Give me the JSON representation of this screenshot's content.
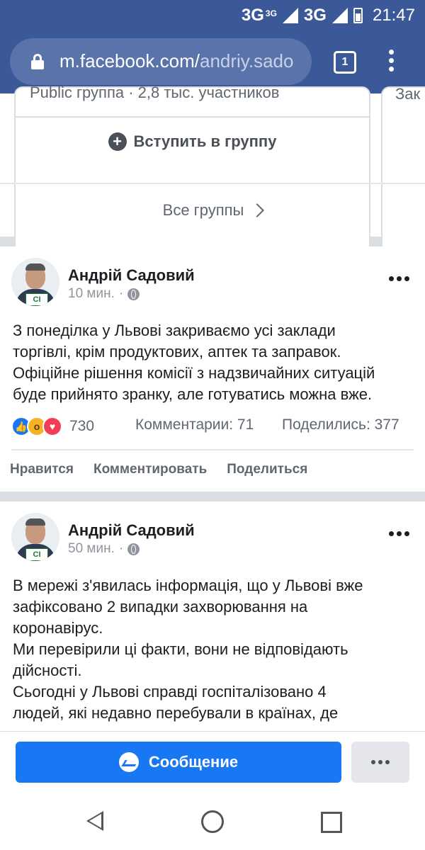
{
  "status_bar": {
    "network1": "3G",
    "network1_sup": "3G",
    "network2": "3G",
    "time": "21:47"
  },
  "browser": {
    "url_domain": "m.facebook.com/",
    "url_path": "andriy.sado",
    "tab_count": "1"
  },
  "groups": {
    "card_meta": "Public группа · 2,8 тыс. участников",
    "join_label": "Вступить в группу",
    "second_card_peek": "Зак",
    "all_groups_label": "Все группы"
  },
  "posts": [
    {
      "author": "Андрій Садовий",
      "time": "10 мин.",
      "lines": [
        "З понеділка у Львові закриваємо усі заклади",
        "торгівлі, крім продуктових, аптек та заправок.",
        "Офіційне рішення комісії з надзвичайних ситуацій",
        "буде прийнято зранку, але готуватись можна вже."
      ],
      "reactions_count": "730",
      "comments": "Комментарии: 71",
      "shares": "Поделились: 377",
      "actions": [
        "Нравится",
        "Комментировать",
        "Поделиться"
      ]
    },
    {
      "author": "Андрій Садовий",
      "time": "50 мин.",
      "lines": [
        "В мережі з'явилась інформація, що у Львові вже",
        "зафіксовано 2 випадки захворювання на",
        "коронавірус.",
        "Ми перевірили ці факти, вони не відповідають",
        "дійсності.",
        "Сьогодні у Львові справді госпіталізовано 4",
        "людей, які недавно перебували в країнах, де"
      ]
    }
  ],
  "bottom_bar": {
    "message_label": "Сообщение"
  },
  "avatar_badge": "СІ",
  "colors": {
    "header": "#3b5998",
    "accent": "#1877f2"
  }
}
